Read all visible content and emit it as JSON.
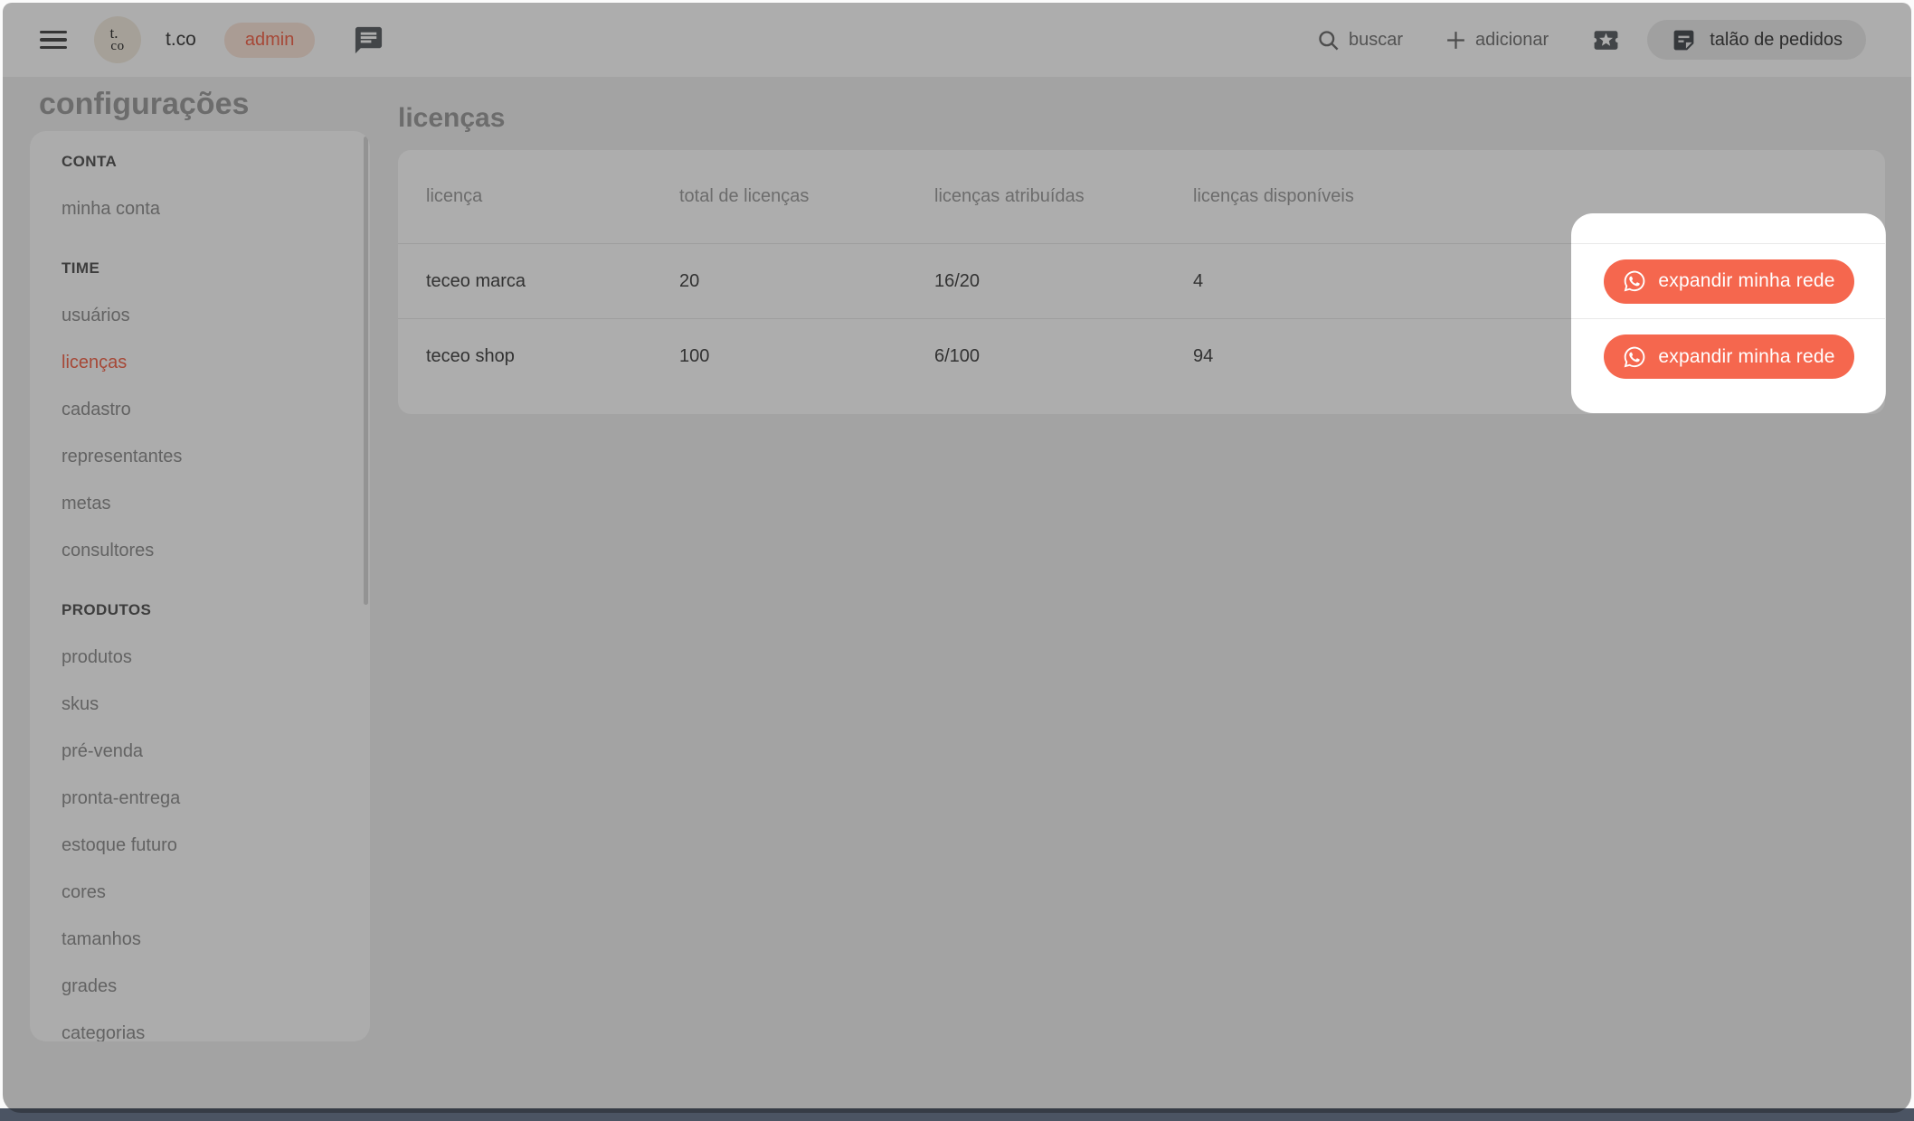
{
  "topbar": {
    "logo_text_top": "t.",
    "logo_text_bottom": "co",
    "brand_name": "t.co",
    "role_badge": "admin",
    "search_label": "buscar",
    "add_label": "adicionar",
    "order_pad_label": "talão de pedidos"
  },
  "sidebar": {
    "title": "configurações",
    "sections": [
      {
        "header": "CONTA",
        "items": [
          {
            "label": "minha conta",
            "active": false
          }
        ]
      },
      {
        "header": "TIME",
        "items": [
          {
            "label": "usuários",
            "active": false
          },
          {
            "label": "licenças",
            "active": true
          },
          {
            "label": "cadastro",
            "active": false
          },
          {
            "label": "representantes",
            "active": false
          },
          {
            "label": "metas",
            "active": false
          },
          {
            "label": "consultores",
            "active": false
          }
        ]
      },
      {
        "header": "PRODUTOS",
        "items": [
          {
            "label": "produtos",
            "active": false
          },
          {
            "label": "skus",
            "active": false
          },
          {
            "label": "pré-venda",
            "active": false
          },
          {
            "label": "pronta-entrega",
            "active": false
          },
          {
            "label": "estoque futuro",
            "active": false
          },
          {
            "label": "cores",
            "active": false
          },
          {
            "label": "tamanhos",
            "active": false
          },
          {
            "label": "grades",
            "active": false
          },
          {
            "label": "categorias",
            "active": false
          }
        ]
      }
    ]
  },
  "main": {
    "title": "licenças",
    "table": {
      "columns": [
        "licença",
        "total de licenças",
        "licenças atribuídas",
        "licenças disponíveis"
      ],
      "rows": [
        {
          "name": "teceo marca",
          "total": "20",
          "assigned": "16/20",
          "available": "4",
          "action_label": "expandir minha rede"
        },
        {
          "name": "teceo shop",
          "total": "100",
          "assigned": "6/100",
          "available": "94",
          "action_label": "expandir minha rede"
        }
      ]
    }
  },
  "colors": {
    "accent": "#f5674e",
    "badge_bg": "#fbe5da",
    "page_bg": "#f0f0f0",
    "card_bg": "#ffffff",
    "overlay": "rgba(15,15,15,0.34)",
    "bottom_bar": "#4b5463"
  }
}
